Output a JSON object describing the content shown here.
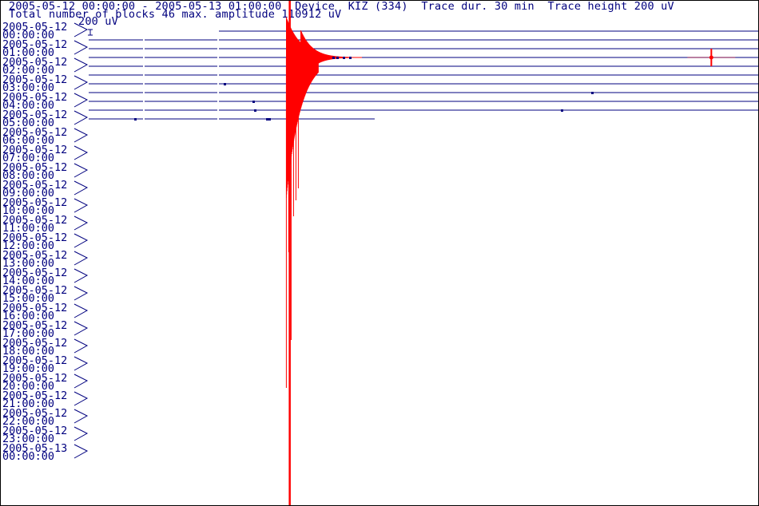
{
  "header": {
    "line1": "2005-05-12 00:00:00 - 2005-05-13 01:00:00  Device  KIZ (334)  Trace dur. 30 min  Trace height 200 uV",
    "line2": "Total number of blocks 46 max. amplitude 110912 uV",
    "scale_label": "200 uV"
  },
  "colors": {
    "trace": "#00007f",
    "event": "#ff0000",
    "text": "#00007f",
    "border": "#000000",
    "background": "#ffffff"
  },
  "chart_data": {
    "type": "seismogram",
    "title": "2005-05-12 00:00:00 - 2005-05-13 01:00:00  Device  KIZ (334)  Trace dur. 30 min  Trace height 200 uV",
    "subtitle": "Total number of blocks 46 max. amplitude 110912 uV",
    "device": "KIZ (334)",
    "trace_duration_min": 30,
    "trace_height_uV": 200,
    "total_blocks": 46,
    "max_amplitude_uV": 110912,
    "hour_labels": [
      [
        "2005-05-12",
        "00:00:00"
      ],
      [
        "2005-05-12",
        "01:00:00"
      ],
      [
        "2005-05-12",
        "02:00:00"
      ],
      [
        "2005-05-12",
        "03:00:00"
      ],
      [
        "2005-05-12",
        "04:00:00"
      ],
      [
        "2005-05-12",
        "05:00:00"
      ],
      [
        "2005-05-12",
        "06:00:00"
      ],
      [
        "2005-05-12",
        "07:00:00"
      ],
      [
        "2005-05-12",
        "08:00:00"
      ],
      [
        "2005-05-12",
        "09:00:00"
      ],
      [
        "2005-05-12",
        "10:00:00"
      ],
      [
        "2005-05-12",
        "11:00:00"
      ],
      [
        "2005-05-12",
        "12:00:00"
      ],
      [
        "2005-05-12",
        "13:00:00"
      ],
      [
        "2005-05-12",
        "14:00:00"
      ],
      [
        "2005-05-12",
        "15:00:00"
      ],
      [
        "2005-05-12",
        "16:00:00"
      ],
      [
        "2005-05-12",
        "17:00:00"
      ],
      [
        "2005-05-12",
        "18:00:00"
      ],
      [
        "2005-05-12",
        "19:00:00"
      ],
      [
        "2005-05-12",
        "20:00:00"
      ],
      [
        "2005-05-12",
        "21:00:00"
      ],
      [
        "2005-05-12",
        "22:00:00"
      ],
      [
        "2005-05-12",
        "23:00:00"
      ],
      [
        "2005-05-13",
        "00:00:00"
      ]
    ],
    "recorded_traces": 11,
    "last_trace_coverage_fraction": 0.42,
    "event": {
      "trace_index": 3,
      "onset_minute_in_trace": 9.0,
      "secondary_burst_trace_index": 3,
      "secondary_burst_minute": 27.9
    },
    "grid": false
  }
}
